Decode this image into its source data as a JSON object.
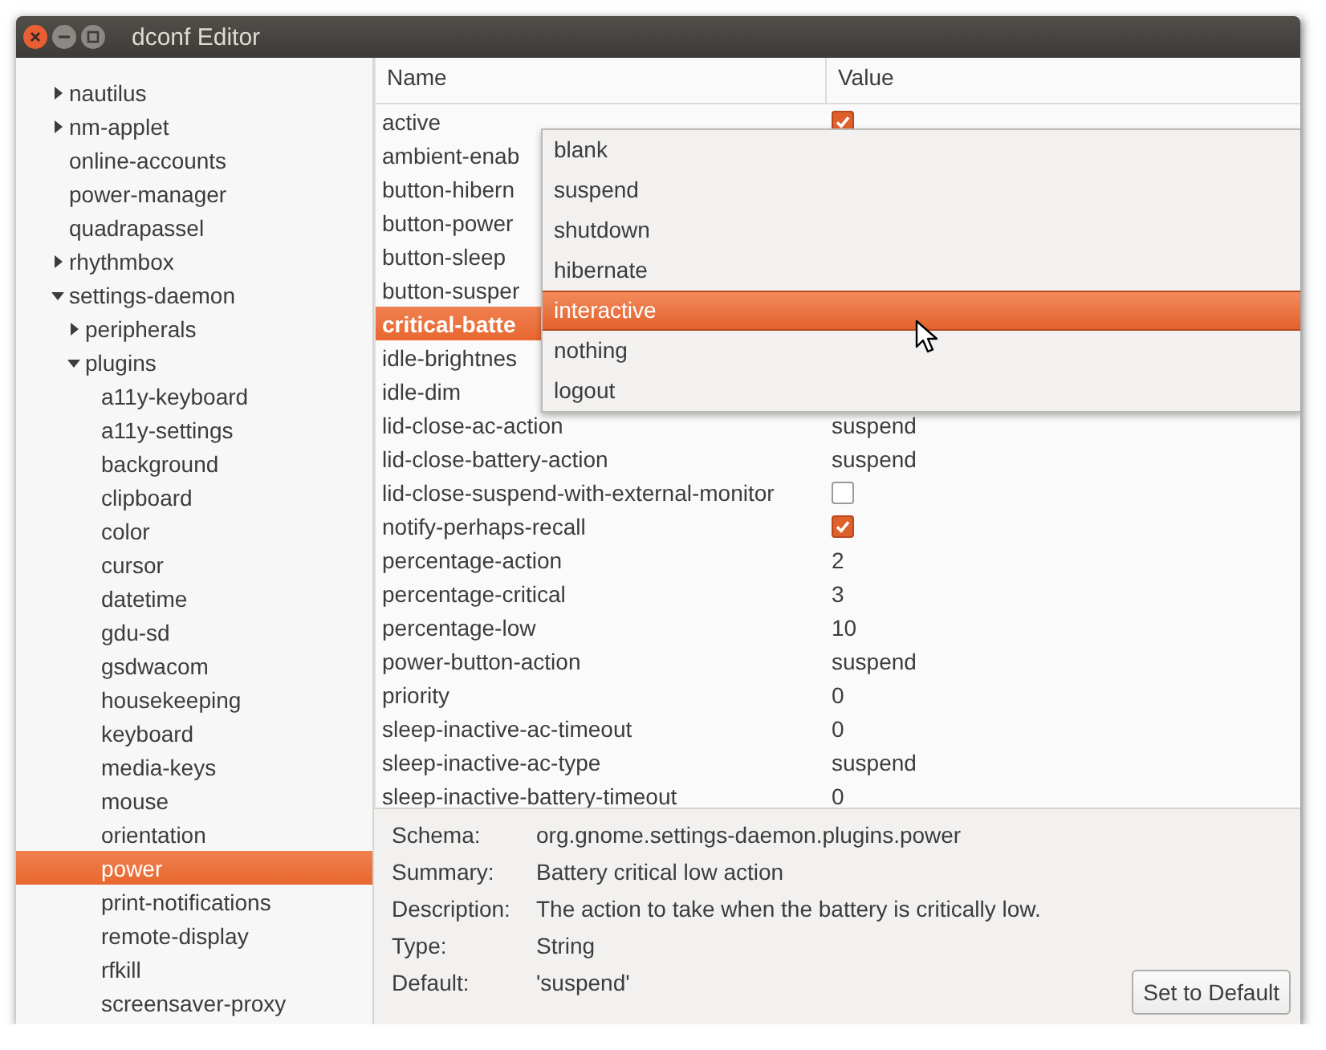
{
  "window": {
    "title": "dconf Editor"
  },
  "sidebar": {
    "items": [
      {
        "label": "nautilus",
        "expanded": false
      },
      {
        "label": "nm-applet",
        "expanded": false
      },
      {
        "label": "online-accounts"
      },
      {
        "label": "power-manager"
      },
      {
        "label": "quadrapassel"
      },
      {
        "label": "rhythmbox",
        "expanded": false
      },
      {
        "label": "settings-daemon",
        "expanded": true,
        "children": [
          {
            "label": "peripherals",
            "expanded": false
          },
          {
            "label": "plugins",
            "expanded": true,
            "children": [
              {
                "label": "a11y-keyboard",
                "selected": false
              },
              {
                "label": "a11y-settings",
                "selected": false
              },
              {
                "label": "background",
                "selected": false
              },
              {
                "label": "clipboard",
                "selected": false
              },
              {
                "label": "color",
                "selected": false
              },
              {
                "label": "cursor",
                "selected": false
              },
              {
                "label": "datetime",
                "selected": false
              },
              {
                "label": "gdu-sd",
                "selected": false
              },
              {
                "label": "gsdwacom",
                "selected": false
              },
              {
                "label": "housekeeping",
                "selected": false
              },
              {
                "label": "keyboard",
                "selected": false
              },
              {
                "label": "media-keys",
                "selected": false
              },
              {
                "label": "mouse",
                "selected": false
              },
              {
                "label": "orientation",
                "selected": false
              },
              {
                "label": "power",
                "selected": true
              },
              {
                "label": "print-notifications",
                "selected": false
              },
              {
                "label": "remote-display",
                "selected": false
              },
              {
                "label": "rfkill",
                "selected": false
              },
              {
                "label": "screensaver-proxy",
                "selected": false
              }
            ]
          }
        ]
      }
    ]
  },
  "table": {
    "columns": [
      "Name",
      "Value"
    ],
    "rows": [
      {
        "name": "active",
        "kind": "check",
        "checked": true,
        "selected": false
      },
      {
        "name": "ambient-enab",
        "selected": false
      },
      {
        "name": "button-hibern",
        "selected": false
      },
      {
        "name": "button-power",
        "selected": false
      },
      {
        "name": "button-sleep",
        "selected": false
      },
      {
        "name": "button-susper",
        "selected": false
      },
      {
        "name": "critical-batte",
        "selected": true
      },
      {
        "name": "idle-brightnes",
        "selected": false
      },
      {
        "name": "idle-dim",
        "selected": false
      },
      {
        "name": "lid-close-ac-action",
        "kind": "text",
        "value": "suspend",
        "selected": false
      },
      {
        "name": "lid-close-battery-action",
        "kind": "text",
        "value": "suspend",
        "selected": false
      },
      {
        "name": "lid-close-suspend-with-external-monitor",
        "kind": "check",
        "checked": false,
        "selected": false
      },
      {
        "name": "notify-perhaps-recall",
        "kind": "check",
        "checked": true,
        "selected": false
      },
      {
        "name": "percentage-action",
        "kind": "text",
        "value": "2",
        "selected": false
      },
      {
        "name": "percentage-critical",
        "kind": "text",
        "value": "3",
        "selected": false
      },
      {
        "name": "percentage-low",
        "kind": "text",
        "value": "10",
        "selected": false
      },
      {
        "name": "power-button-action",
        "kind": "text",
        "value": "suspend",
        "selected": false
      },
      {
        "name": "priority",
        "kind": "text",
        "value": "0",
        "selected": false
      },
      {
        "name": "sleep-inactive-ac-timeout",
        "kind": "text",
        "value": "0",
        "selected": false
      },
      {
        "name": "sleep-inactive-ac-type",
        "kind": "text",
        "value": "suspend",
        "selected": false
      },
      {
        "name": "sleep-inactive-battery-timeout",
        "kind": "text",
        "value": "0",
        "selected": false
      }
    ]
  },
  "dropdown": {
    "options": [
      {
        "label": "blank",
        "selected": false
      },
      {
        "label": "suspend",
        "selected": false
      },
      {
        "label": "shutdown",
        "selected": false
      },
      {
        "label": "hibernate",
        "selected": false
      },
      {
        "label": "interactive",
        "selected": true
      },
      {
        "label": "nothing",
        "selected": false
      },
      {
        "label": "logout",
        "selected": false
      }
    ]
  },
  "details": [
    {
      "label": "Schema:",
      "value": "org.gnome.settings-daemon.plugins.power"
    },
    {
      "label": "Summary:",
      "value": "Battery critical low action"
    },
    {
      "label": "Description:",
      "value": "The action to take when the battery is critically low."
    },
    {
      "label": "Type:",
      "value": "String"
    },
    {
      "label": "Default:",
      "value": "'suspend'"
    }
  ],
  "buttons": [
    "Set to Default"
  ]
}
